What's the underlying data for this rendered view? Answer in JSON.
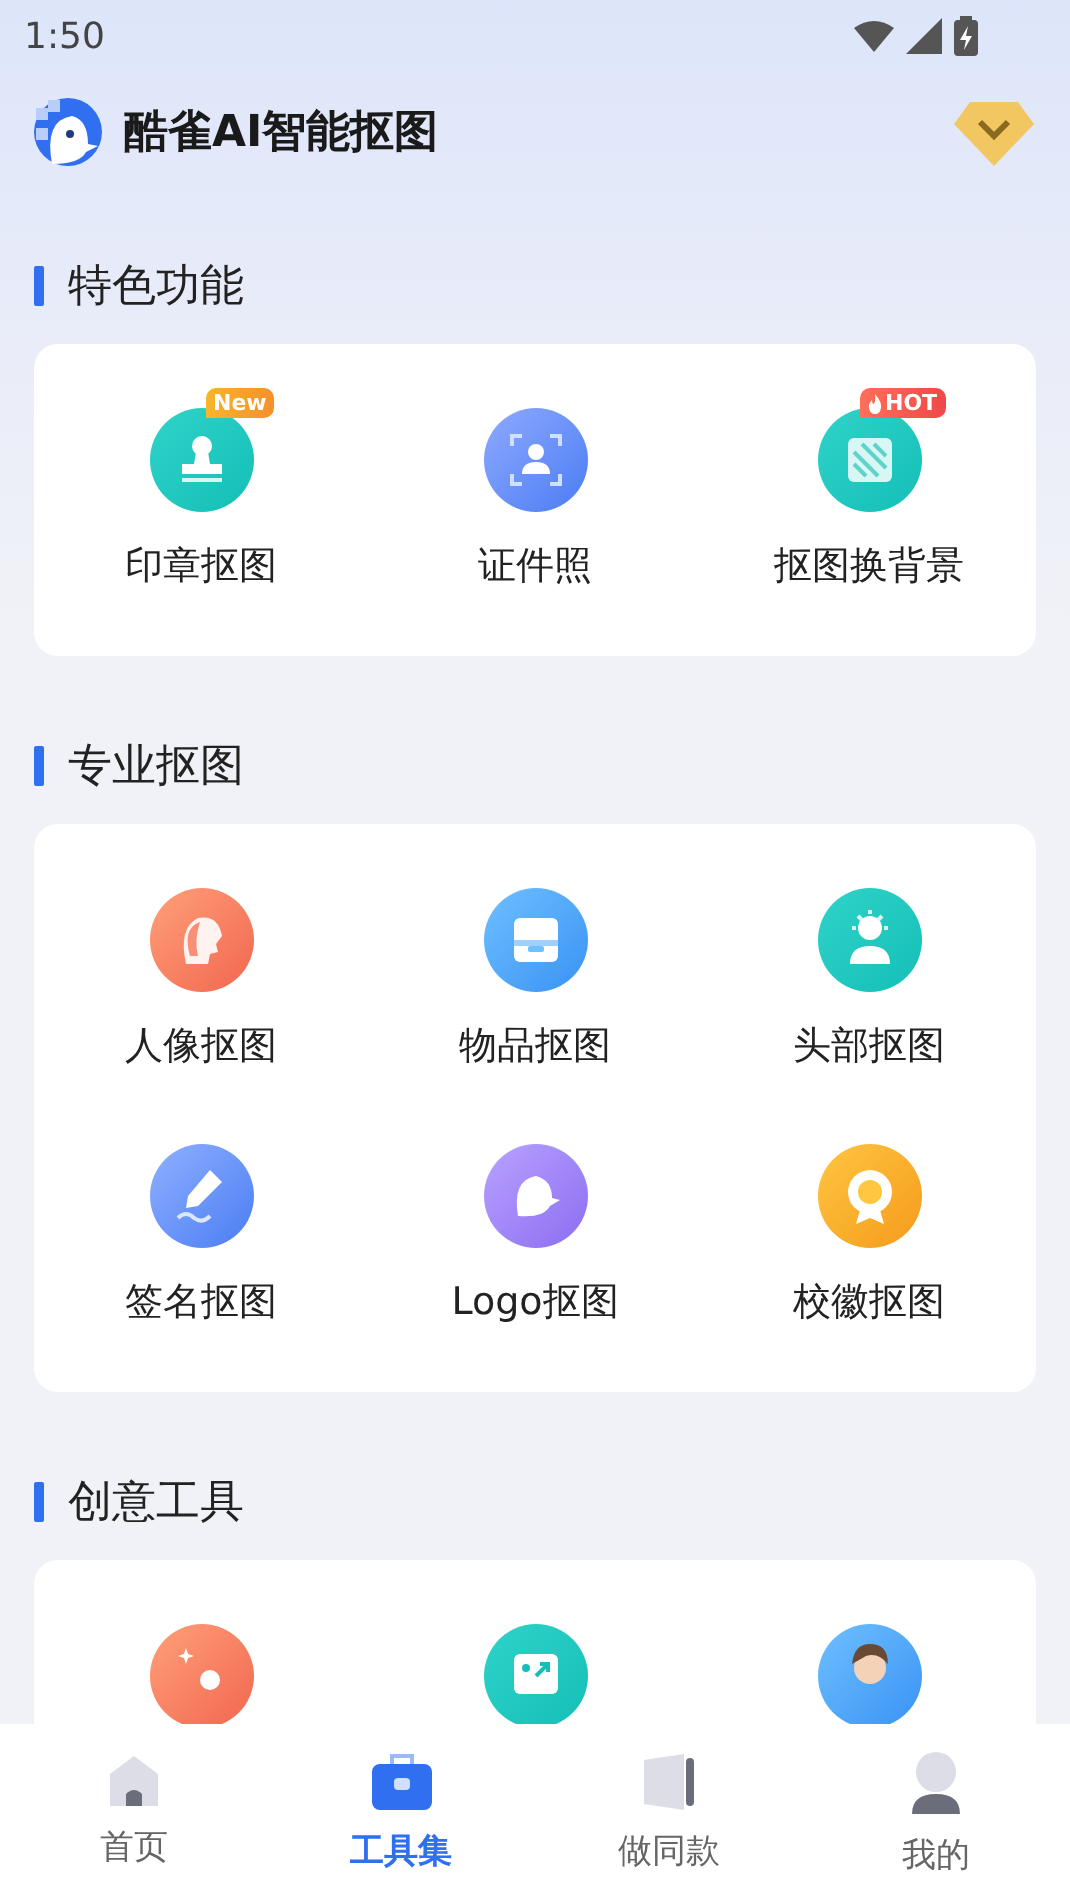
{
  "status_bar": {
    "time": "1:50"
  },
  "header": {
    "title": "酷雀AI智能抠图"
  },
  "sections": [
    {
      "title": "特色功能",
      "items": [
        {
          "label": "印章抠图",
          "kind": "stamp",
          "badge": {
            "kind": "new",
            "text": "New"
          }
        },
        {
          "label": "证件照",
          "kind": "idphoto"
        },
        {
          "label": "抠图换背景",
          "kind": "background",
          "badge": {
            "kind": "hot",
            "text": "HOT"
          }
        }
      ]
    },
    {
      "title": "专业抠图",
      "items": [
        {
          "label": "人像抠图",
          "kind": "portrait"
        },
        {
          "label": "物品抠图",
          "kind": "product"
        },
        {
          "label": "头部抠图",
          "kind": "head"
        },
        {
          "label": "签名抠图",
          "kind": "signature"
        },
        {
          "label": "Logo抠图",
          "kind": "logo"
        },
        {
          "label": "校徽抠图",
          "kind": "emblem"
        }
      ]
    },
    {
      "title": "创意工具",
      "items": [
        {
          "kind": "magic"
        },
        {
          "kind": "expand"
        },
        {
          "kind": "avatar"
        }
      ]
    }
  ],
  "tabs": [
    {
      "label": "首页",
      "kind": "home",
      "selected": false
    },
    {
      "label": "工具集",
      "kind": "toolbox",
      "selected": true
    },
    {
      "label": "做同款",
      "kind": "cards",
      "selected": false
    },
    {
      "label": "我的",
      "kind": "user",
      "selected": false
    }
  ]
}
